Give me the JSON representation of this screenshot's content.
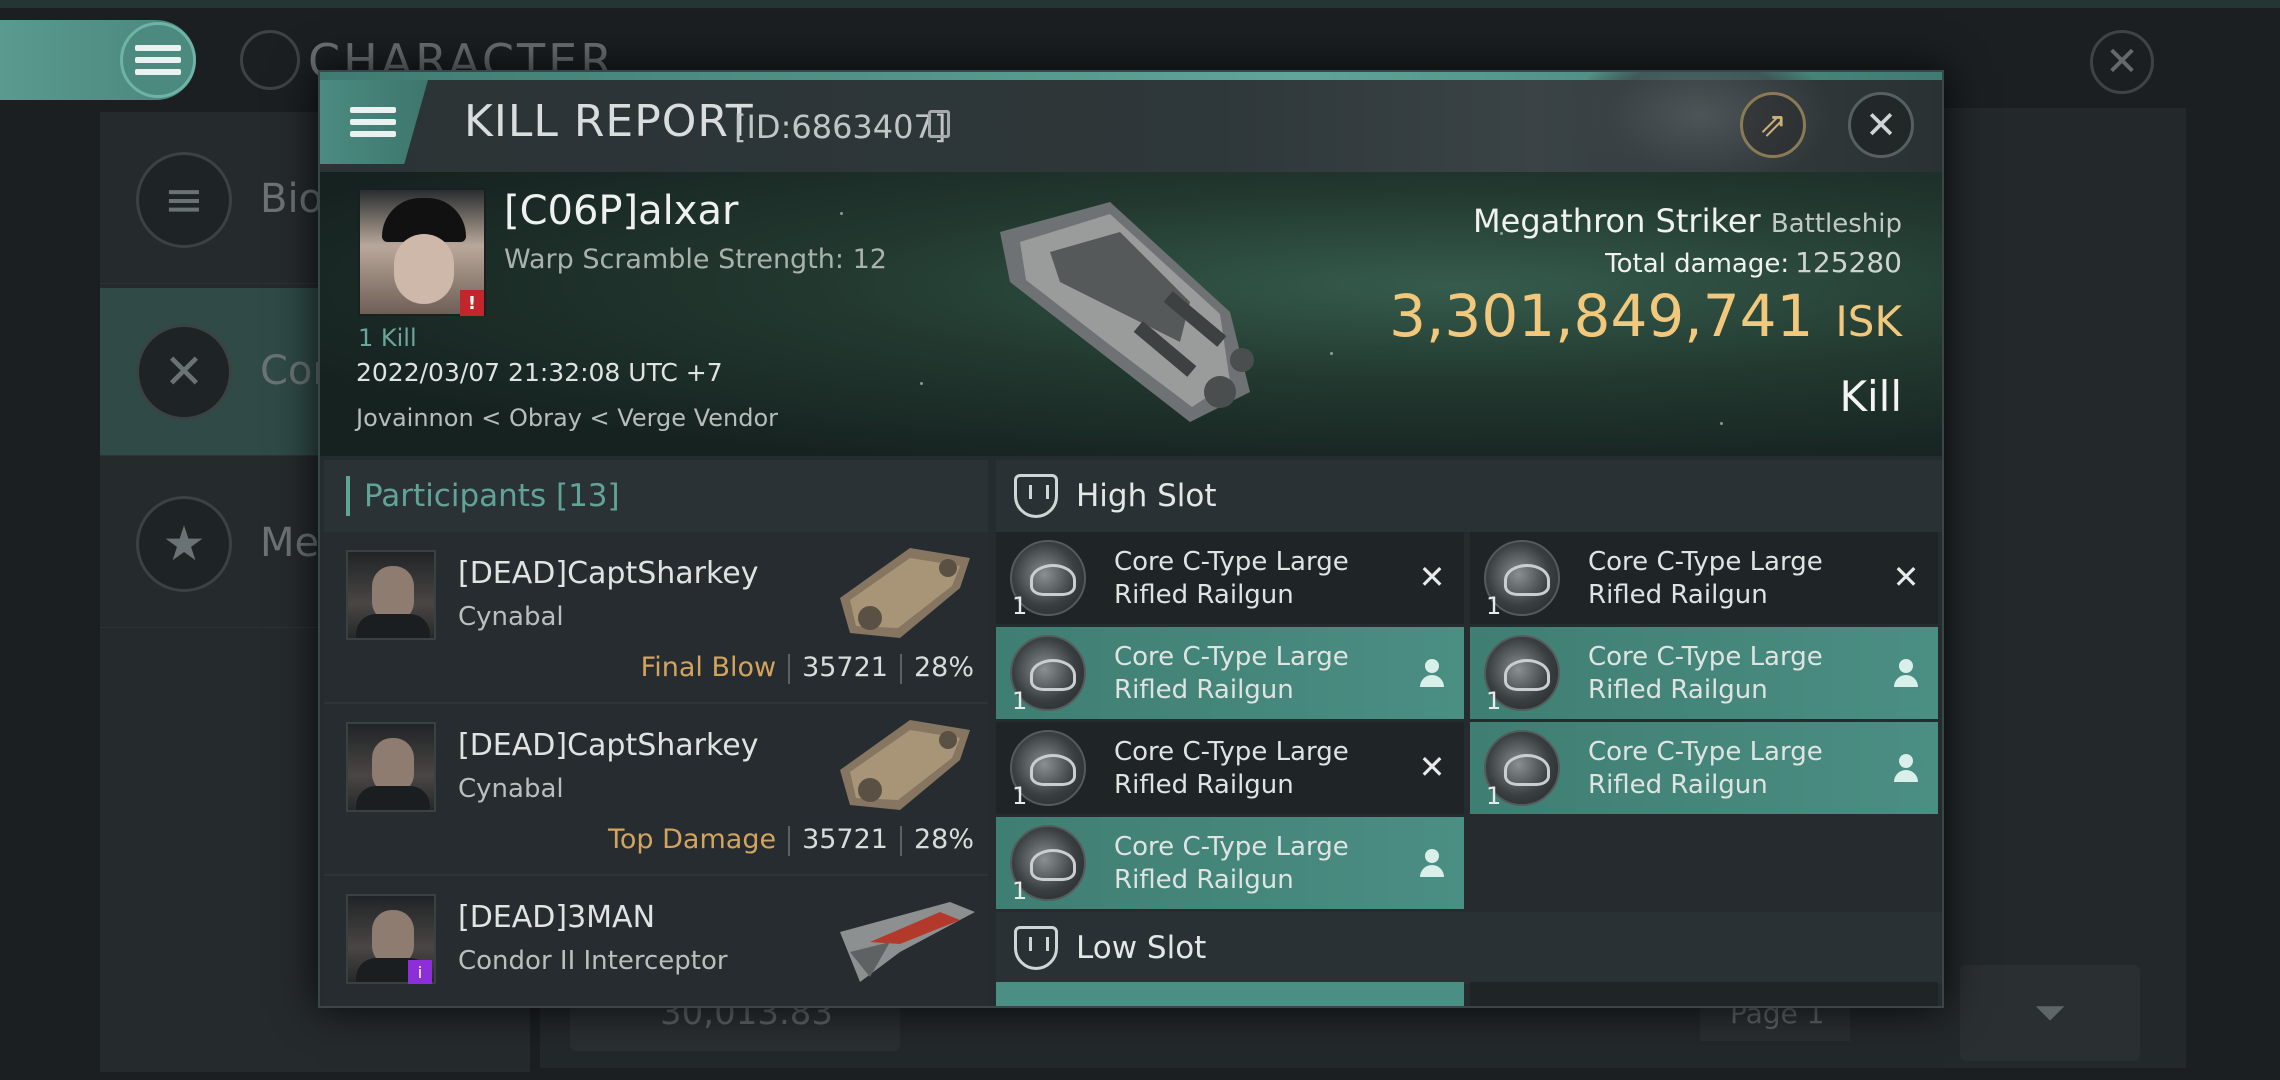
{
  "background": {
    "title": "CHARACTER",
    "sidebar": [
      {
        "label": "Bio",
        "icon": "list-icon"
      },
      {
        "label": "Combat",
        "icon": "crossed-swords-icon"
      },
      {
        "label": "Medals",
        "icon": "star-icon"
      }
    ],
    "bottom_value": "30,013.83",
    "page_label": "Page 1"
  },
  "kill_report": {
    "title": "KILL REPORT",
    "id_label": "[ID:6863407]",
    "victim": {
      "name": "[C06P]alxar",
      "subtitle": "Warp Scramble Strength: 12",
      "kills": "1 Kill",
      "timestamp": "2022/03/07 21:32:08 UTC +7",
      "location": "Jovainnon < Obray < Verge Vendor",
      "ship_name": "Megathron Striker",
      "ship_class": "Battleship",
      "total_damage_label": "Total damage:",
      "total_damage": "125280",
      "isk_value": "3,301,849,741",
      "isk_unit": "ISK",
      "result": "Kill"
    },
    "participants": {
      "label": "Participants",
      "count": "[13]",
      "rows": [
        {
          "name": "[DEAD]CaptSharkey",
          "ship": "Cynabal",
          "tag": "Final Blow",
          "damage": "35721",
          "percent": "28%"
        },
        {
          "name": "[DEAD]CaptSharkey",
          "ship": "Cynabal",
          "tag": "Top Damage",
          "damage": "35721",
          "percent": "28%"
        },
        {
          "name": "[DEAD]3MAN",
          "ship": "Condor II Interceptor",
          "tag": "",
          "damage": "",
          "percent": ""
        }
      ]
    },
    "high_slot": {
      "label": "High Slot",
      "modules": [
        {
          "name": "Core C-Type Large Rifled Railgun",
          "qty": "1",
          "status": "destroyed"
        },
        {
          "name": "Core C-Type Large Rifled Railgun",
          "qty": "1",
          "status": "destroyed"
        },
        {
          "name": "Core C-Type Large Rifled Railgun",
          "qty": "1",
          "status": "dropped"
        },
        {
          "name": "Core C-Type Large Rifled Railgun",
          "qty": "1",
          "status": "dropped"
        },
        {
          "name": "Core C-Type Large Rifled Railgun",
          "qty": "1",
          "status": "destroyed"
        },
        {
          "name": "Core C-Type Large Rifled Railgun",
          "qty": "1",
          "status": "dropped"
        },
        {
          "name": "Core C-Type Large Rifled Railgun",
          "qty": "1",
          "status": "dropped"
        }
      ]
    },
    "low_slot": {
      "label": "Low Slot"
    },
    "colors": {
      "accent": "#5ea596",
      "isk": "#f2c87c",
      "final_blow": "#d3a45e",
      "dropped": "#4b8e83"
    }
  }
}
